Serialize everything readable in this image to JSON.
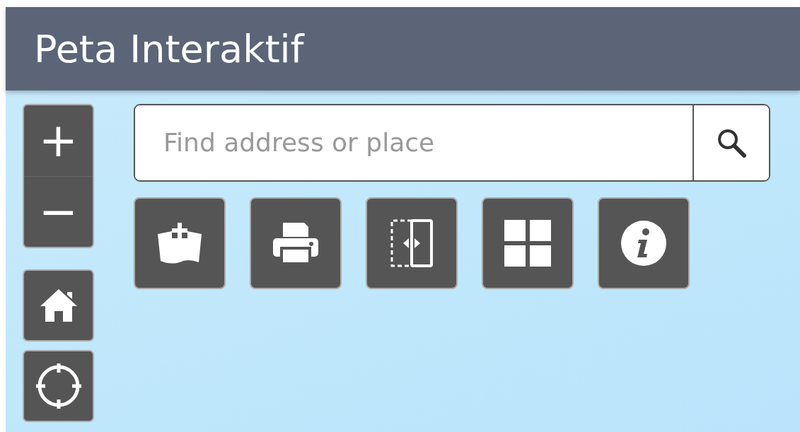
{
  "header": {
    "title": "Peta Interaktif"
  },
  "zoom": {
    "in_label": "+",
    "out_label": "−"
  },
  "search": {
    "placeholder": "Find address or place"
  }
}
